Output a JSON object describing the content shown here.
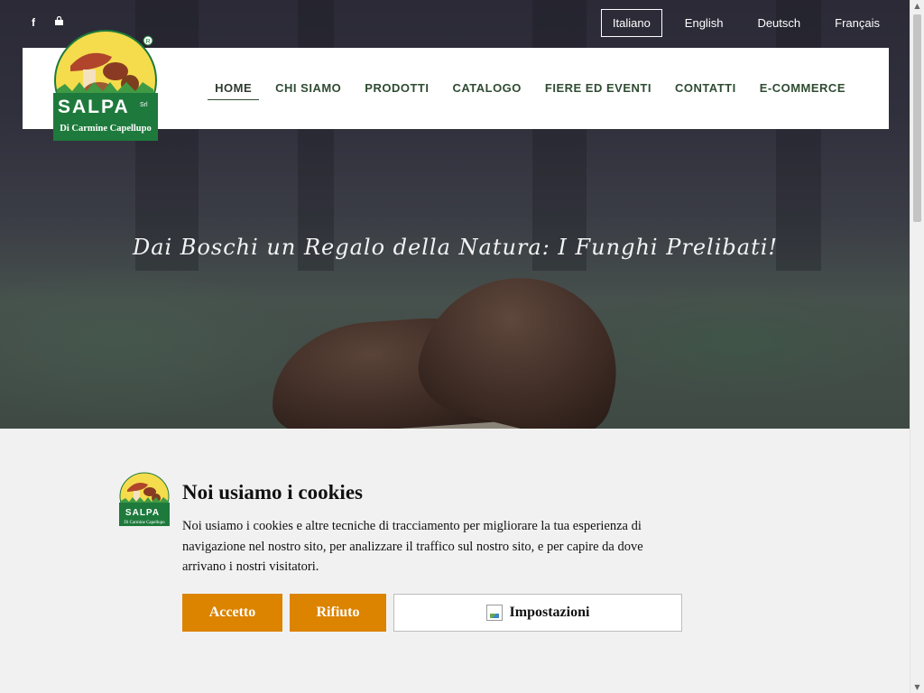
{
  "social": {
    "facebook_icon": "f",
    "bag_icon": "shopping-bag"
  },
  "languages": [
    {
      "label": "Italiano",
      "active": true
    },
    {
      "label": "English"
    },
    {
      "label": "Deutsch"
    },
    {
      "label": "Français"
    }
  ],
  "logo": {
    "brand": "SALPA",
    "suffix": "Srl",
    "tagline": "Di Carmine Capellupo"
  },
  "nav": [
    {
      "label": "HOME"
    },
    {
      "label": "CHI SIAMO"
    },
    {
      "label": "PRODOTTI"
    },
    {
      "label": "CATALOGO"
    },
    {
      "label": "FIERE ED EVENTI"
    },
    {
      "label": "CONTATTI"
    },
    {
      "label": "E-COMMERCE"
    }
  ],
  "hero": {
    "tagline": "Dai Boschi un Regalo della Natura: I Funghi Prelibati!"
  },
  "cookie": {
    "title": "Noi usiamo i cookies",
    "text": "Noi usiamo i cookies e altre tecniche di tracciamento per migliorare la tua esperienza di navigazione nel nostro sito, per analizzare il traffico sul nostro sito, e per capire da dove arrivano i nostri visitatori.",
    "accept": "Accetto",
    "reject": "Rifiuto",
    "settings": "Impostazioni"
  },
  "colors": {
    "nav_green": "#2f4c32",
    "accent_orange": "#dc8300",
    "logo_green": "#1e7a3c",
    "logo_yellow": "#f5dc4c"
  }
}
